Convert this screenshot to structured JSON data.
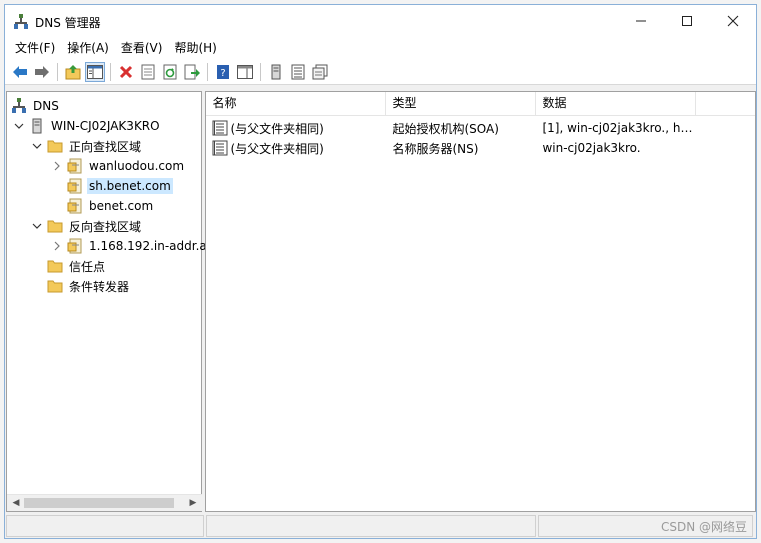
{
  "window": {
    "title": "DNS 管理器",
    "controls": {
      "minimize": "—",
      "maximize": "☐",
      "close": "✕"
    }
  },
  "menu": [
    "文件(F)",
    "操作(A)",
    "查看(V)",
    "帮助(H)"
  ],
  "tree": {
    "root": "DNS",
    "server": "WIN-CJ02JAK3KRO",
    "forward_zone": "正向查找区域",
    "forward_children": [
      "wanluodou.com",
      "sh.benet.com",
      "benet.com"
    ],
    "reverse_zone": "反向查找区域",
    "reverse_children": [
      "1.168.192.in-addr.a"
    ],
    "trust_points": "信任点",
    "conditional_forwarders": "条件转发器"
  },
  "list": {
    "columns": [
      "名称",
      "类型",
      "数据"
    ],
    "rows": [
      {
        "name": "(与父文件夹相同)",
        "type": "起始授权机构(SOA)",
        "data": "[1], win-cj02jak3kro., ho..."
      },
      {
        "name": "(与父文件夹相同)",
        "type": "名称服务器(NS)",
        "data": "win-cj02jak3kro."
      }
    ]
  },
  "watermark": "CSDN @网络豆",
  "colors": {
    "selection": "#cce8ff",
    "folder": "#f3c95a",
    "delete_red": "#d83030",
    "nav_blue": "#2a78c6"
  }
}
